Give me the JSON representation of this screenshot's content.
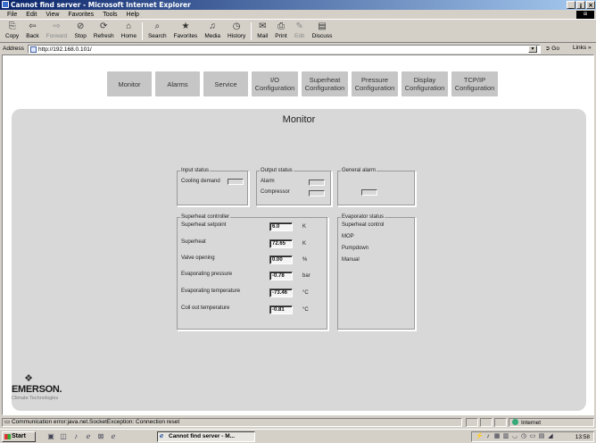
{
  "window": {
    "title": "Cannot find server - Microsoft Internet Explorer",
    "buttons": [
      "_",
      "¡",
      "×"
    ]
  },
  "menu": [
    "File",
    "Edit",
    "View",
    "Favorites",
    "Tools",
    "Help"
  ],
  "toolbar": {
    "copy": "Copy",
    "back": "Back",
    "forward": "Forward",
    "stop": "Stop",
    "refresh": "Refresh",
    "home": "Home",
    "search": "Search",
    "favorites": "Favorites",
    "media": "Media",
    "history": "History",
    "mail": "Mail",
    "print": "Print",
    "edit": "Edit",
    "discuss": "Discuss"
  },
  "address": {
    "label": "Address",
    "url": "http://192.168.0.101/",
    "go": "Go",
    "links": "Links »"
  },
  "nav": [
    {
      "label": "Monitor"
    },
    {
      "label": "Alarms"
    },
    {
      "label": "Service"
    },
    {
      "label": "I/O\nConfiguration"
    },
    {
      "label": "Superheat\nConfiguration"
    },
    {
      "label": "Pressure\nConfiguration"
    },
    {
      "label": "Display\nConfiguration"
    },
    {
      "label": "TCP/IP\nConfiguration"
    }
  ],
  "monitor": {
    "title": "Monitor",
    "input_status": {
      "legend": "Input status",
      "cooling_demand": "Cooling demand"
    },
    "output_status": {
      "legend": "Output status",
      "alarm": "Alarm",
      "compressor": "Compressor"
    },
    "general_alarm": {
      "legend": "General alarm"
    },
    "superheat_controller": {
      "legend": "Superheat controller",
      "rows": [
        {
          "label": "Superheat setpoint",
          "value": "6.0",
          "unit": "K"
        },
        {
          "label": "Superheat",
          "value": "72.65",
          "unit": "K"
        },
        {
          "label": "Valve opening",
          "value": "0.00",
          "unit": "%"
        },
        {
          "label": "Evaporating pressure",
          "value": "-0.78",
          "unit": "bar"
        },
        {
          "label": "Evaporating temperature",
          "value": "-73.46",
          "unit": "°C"
        },
        {
          "label": "Coil out temperature",
          "value": "-0.81",
          "unit": "°C"
        }
      ]
    },
    "evaporator_status": {
      "legend": "Evaporator status",
      "items": [
        "Superheat control",
        "MOP",
        "Pumpdown",
        "Manual"
      ]
    }
  },
  "logo": {
    "name": "EMERSON.",
    "tagline": "Climate Technologies"
  },
  "status": {
    "text": "Communication error:java.net.SocketException: Connection reset",
    "zone": "Internet"
  },
  "taskbar": {
    "start": "Start",
    "task": "Cannot find server - M...",
    "clock": "13:58"
  }
}
